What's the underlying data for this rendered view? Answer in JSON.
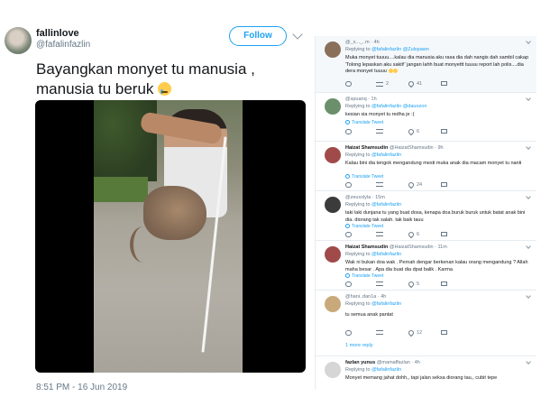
{
  "tweet": {
    "author_name": "fallinlove",
    "author_handle": "@fafalinfazlin",
    "follow_label": "Follow",
    "text": "Bayangkan monyet tu manusia , manusia tu beruk",
    "emoji": "crying-face",
    "timestamp": "8:51 PM - 16 Jun 2019"
  },
  "replies": [
    {
      "name": "",
      "handle": "@_s..._..m",
      "time": "4h",
      "replying_prefix": "Replying to",
      "replying_to": "@fafalinfazlin @Zulspawn",
      "text": "Muka monyet tuuuu....kalau dia manusia aku rasa dia dah nangis dah sambil cakap 'Tolong lepaskan aku sakit!' jangan lahh buat monyettt tuuuu report lah polis....dia dera monyet tuuuu",
      "translate": "",
      "counts": [
        "",
        "2",
        "41",
        ""
      ],
      "avatar_color": "#8a6f5a"
    },
    {
      "name": "",
      "handle": "@spuanq",
      "time": "1h",
      "replying_prefix": "Replying to",
      "replying_to": "@fafalinfazlin @dauozon",
      "text": "kesian sia monyet tu redha je :(",
      "translate": "Translate Tweet",
      "counts": [
        "",
        "",
        "6",
        ""
      ],
      "avatar_color": "#6b8f6b"
    },
    {
      "name": "Haizat Shamsudin",
      "handle": "@HaizatShamsudin",
      "time": "9h",
      "replying_prefix": "Replying to",
      "replying_to": "@fafalinfazlin",
      "text": "Kalau bini dia tengok mengandung mesti muka anak dia macam monyet tu nanti",
      "translate": "Translate Tweet",
      "counts": [
        "",
        "",
        "24",
        ""
      ],
      "avatar_color": "#a04a4a"
    },
    {
      "name": "",
      "handle": "@zeuxxlyla",
      "time": "15m",
      "replying_prefix": "Replying to",
      "replying_to": "@fafalinfazlin",
      "text": "taki laki dunjana tu yang buat dosa, kenapa doa buruk buruk untuk batat anak bini dia. diorang tak salah. tak baik tauu",
      "translate": "Translate Tweet",
      "counts": [
        "",
        "",
        "6",
        ""
      ],
      "avatar_color": "#3b3b3b"
    },
    {
      "name": "Haizat Shamsudin",
      "handle": "@HaizatShamsudin",
      "time": "11m",
      "replying_prefix": "Replying to",
      "replying_to": "@fafalinfazlin",
      "text": "Wak ni bukan doa wak . Pernah dengar berkenan kalau orang mengandung ? Allah maha besar . Apa dia buat dia dpat balik . Karma",
      "translate": "Translate Tweet",
      "counts": [
        "",
        "",
        "5",
        ""
      ],
      "avatar_color": "#a04a4a"
    },
    {
      "name": "",
      "handle": "@hani..dan1a",
      "time": "4h",
      "replying_prefix": "Replying to",
      "replying_to": "@fafalinfazlin",
      "text": "tu semua anak pantat",
      "translate": "",
      "counts": [
        "",
        "",
        "12",
        ""
      ],
      "more": "1 more reply",
      "avatar_color": "#c9a97a"
    },
    {
      "name": "fazlan yunus",
      "handle": "@mamaffazlan",
      "time": "4h",
      "replying_prefix": "Replying to",
      "replying_to": "@fafalinfazlin",
      "text": "Monyet memang jahat dohh,, tapi jalan seksa diorang tau,, cubit tepe",
      "translate": "",
      "counts": [
        "",
        "",
        "",
        ""
      ],
      "avatar_color": "#d6d6d6"
    }
  ]
}
